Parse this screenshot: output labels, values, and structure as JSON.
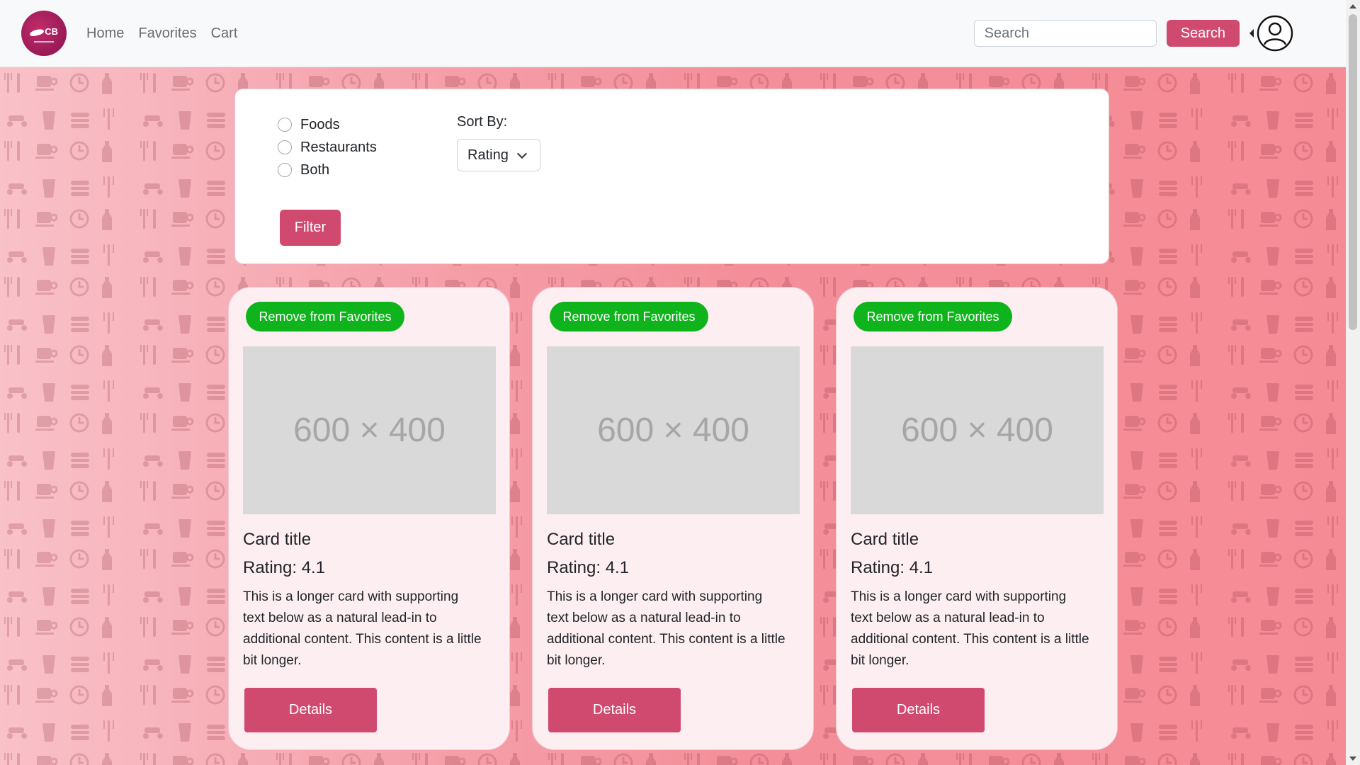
{
  "brand": {
    "logo_text": "CB"
  },
  "nav": {
    "links": [
      "Home",
      "Favorites",
      "Cart"
    ]
  },
  "search": {
    "placeholder": "Search",
    "button_label": "Search"
  },
  "filters": {
    "options": [
      "Foods",
      "Restaurants",
      "Both"
    ],
    "sort_label": "Sort By:",
    "sort_selected": "Rating",
    "filter_button": "Filter"
  },
  "cards": [
    {
      "favorite_button": "Remove from Favorites",
      "image_placeholder": "600 × 400",
      "title": "Card title",
      "rating": "Rating: 4.1",
      "text": "This is a longer card with supporting text below as a natural lead-in to additional content. This content is a little bit longer.",
      "details_button": "Details"
    },
    {
      "favorite_button": "Remove from Favorites",
      "image_placeholder": "600 × 400",
      "title": "Card title",
      "rating": "Rating: 4.1",
      "text": "This is a longer card with supporting text below as a natural lead-in to additional content. This content is a little bit longer.",
      "details_button": "Details"
    },
    {
      "favorite_button": "Remove from Favorites",
      "image_placeholder": "600 × 400",
      "title": "Card title",
      "rating": "Rating: 4.1",
      "text": "This is a longer card with supporting text below as a natural lead-in to additional content. This content is a little bit longer.",
      "details_button": "Details"
    }
  ],
  "icons": {
    "user": "user-circle-icon",
    "dropdown": "chevron-down-icon",
    "background_pattern": [
      "scooter-icon",
      "coffee-cup-icon",
      "fork-knife-icon",
      "clock-icon",
      "bottle-icon",
      "drink-cup-icon",
      "burger-icon"
    ]
  },
  "colors": {
    "accent": "#d04a70",
    "favorite_green": "#0fb41c",
    "card_background": "#fdeef1",
    "page_background": "#f48f99"
  }
}
